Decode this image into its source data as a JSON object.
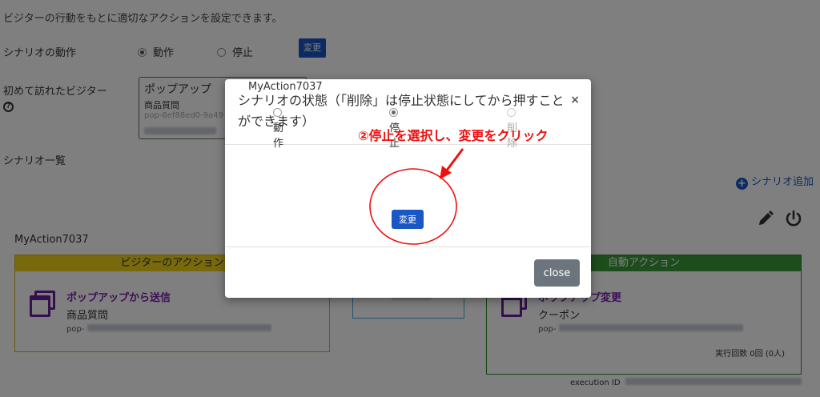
{
  "page": {
    "intro": "ビジターの行動をもとに適切なアクションを設定できます。",
    "scenario_action_label": "シナリオの動作",
    "opt_run": "動作",
    "opt_stop": "停止",
    "change_label": "変更",
    "first_visitor_label": "初めて訪れたビジター",
    "popup_title": "ポップアップ",
    "popup_sub": "商品質問",
    "popup_id": "pop-8ef88ed0-9a49",
    "scenario_list_label": "シナリオ一覧",
    "add_scenario": "シナリオ追加",
    "action_name": "MyAction7037",
    "visitor_action_header": "ビジターのアクション",
    "auto_action_header": "自動アクション",
    "popup_send": "ポップアップから送信",
    "product_question": "商品質問",
    "pop_prefix": "pop-",
    "popup_change": "ポップアップ変更",
    "coupon": "クーポン",
    "exec_count": "実行回数 0回 (0人)",
    "exec_id_label": "execution ID"
  },
  "modal": {
    "title": "シナリオの状態（「削除」は停止状態にしてから押すことができます）",
    "close_x": "×",
    "action_name": "MyAction7037",
    "options": [
      "動作",
      "停止",
      "削除"
    ],
    "selected": "停止",
    "change_button": "変更",
    "close_button": "close"
  },
  "annotation": {
    "text": "②停止を選択し、変更をクリック",
    "color": "#ee1111"
  },
  "colors": {
    "primary": "#1a56c4",
    "visitor_header": "#f0d21a",
    "auto_header": "#3a9a3a",
    "purple": "#7a1fb0"
  }
}
